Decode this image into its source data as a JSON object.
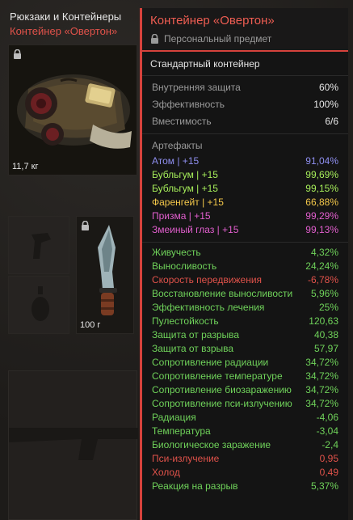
{
  "inventory": {
    "category_title": "Рюкзаки и Контейнеры",
    "selected_item": "Контейнер «Овертон»",
    "main_slot_weight": "11,7 кг",
    "knife_slot_weight": "100 г"
  },
  "tooltip": {
    "name": "Контейнер «Овертон»",
    "subtitle": "Персональный предмет",
    "item_type": "Стандартный контейнер",
    "stats": [
      {
        "label": "Внутренняя защита",
        "value": "60%"
      },
      {
        "label": "Эффективность",
        "value": "100%"
      },
      {
        "label": "Вместимость",
        "value": "6/6"
      }
    ],
    "artifacts_title": "Артефакты",
    "artifacts": [
      {
        "label": "Атом | +15",
        "value": "91,04%",
        "color": "#8f8ff0"
      },
      {
        "label": "Бубльгум | +15",
        "value": "99,69%",
        "color": "#a6ee5a"
      },
      {
        "label": "Бубльгум | +15",
        "value": "99,15%",
        "color": "#a6ee5a"
      },
      {
        "label": "Фаренгейт | +15",
        "value": "66,88%",
        "color": "#f4c84a"
      },
      {
        "label": "Призма | +15",
        "value": "99,29%",
        "color": "#e35fcf"
      },
      {
        "label": "Змеиный глаз | +15",
        "value": "99,13%",
        "color": "#e35fcf"
      }
    ],
    "effects": [
      {
        "label": "Живучесть",
        "value": "4,32%",
        "color": "#6fd25a"
      },
      {
        "label": "Выносливость",
        "value": "24,24%",
        "color": "#6fd25a"
      },
      {
        "label": "Скорость передвижения",
        "value": "-6,78%",
        "color": "#e0524a"
      },
      {
        "label": "Восстановление выносливости",
        "value": "5,96%",
        "color": "#6fd25a"
      },
      {
        "label": "Эффективность лечения",
        "value": "25%",
        "color": "#6fd25a"
      },
      {
        "label": "Пулестойкость",
        "value": "120,63",
        "color": "#6fd25a"
      },
      {
        "label": "Защита от разрыва",
        "value": "40,38",
        "color": "#6fd25a"
      },
      {
        "label": "Защита от взрыва",
        "value": "57,97",
        "color": "#6fd25a"
      },
      {
        "label": "Сопротивление радиации",
        "value": "34,72%",
        "color": "#6fd25a"
      },
      {
        "label": "Сопротивление температуре",
        "value": "34,72%",
        "color": "#6fd25a"
      },
      {
        "label": "Сопротивление биозаражению",
        "value": "34,72%",
        "color": "#6fd25a"
      },
      {
        "label": "Сопротивление пси-излучению",
        "value": "34,72%",
        "color": "#6fd25a"
      },
      {
        "label": "Радиация",
        "value": "-4,06",
        "color": "#6fd25a"
      },
      {
        "label": "Температура",
        "value": "-3,04",
        "color": "#6fd25a"
      },
      {
        "label": "Биологическое заражение",
        "value": "-2,4",
        "color": "#6fd25a"
      },
      {
        "label": "Пси-излучение",
        "value": "0,95",
        "color": "#e0524a"
      },
      {
        "label": "Холод",
        "value": "0,49",
        "color": "#e0524a"
      },
      {
        "label": "Реакция на разрыв",
        "value": "5,37%",
        "color": "#6fd25a"
      }
    ]
  }
}
